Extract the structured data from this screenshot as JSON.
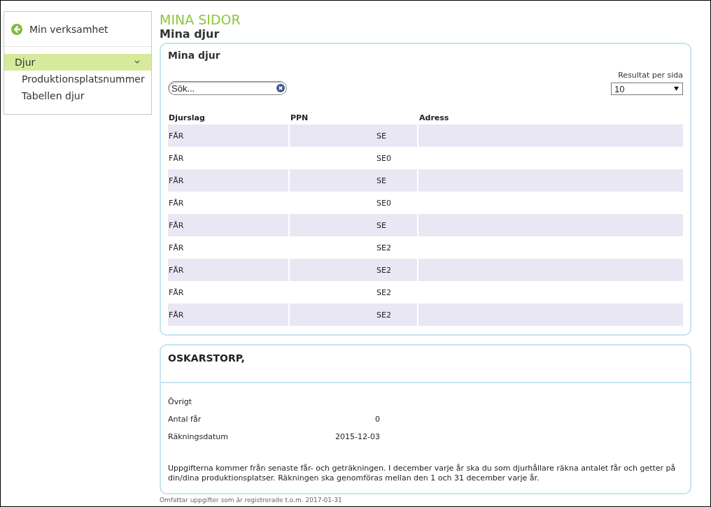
{
  "sidebar": {
    "back_link": "Min verksamhet",
    "items": [
      {
        "label": "Djur",
        "selected": true,
        "expanded": true,
        "children": [
          {
            "label": "Produktionsplatsnummer",
            "selected": false
          },
          {
            "label": "Tabellen djur",
            "selected": false
          }
        ]
      }
    ]
  },
  "header": {
    "section": "MINA SIDOR",
    "title": "Mina djur"
  },
  "animals_panel": {
    "title": "Mina djur",
    "search": {
      "placeholder": "Sök..."
    },
    "page_size": {
      "label": "Resultat per sida",
      "value": "10"
    },
    "table": {
      "columns": [
        "Djurslag",
        "PPN",
        "Adress"
      ],
      "rows": [
        {
          "cells": [
            "FÅR",
            "SE",
            ""
          ]
        },
        {
          "cells": [
            "FÅR",
            "SE0",
            ""
          ]
        },
        {
          "cells": [
            "FÅR",
            "SE",
            ""
          ]
        },
        {
          "cells": [
            "FÅR",
            "SE0",
            ""
          ]
        },
        {
          "cells": [
            "FÅR",
            "SE",
            ""
          ]
        },
        {
          "cells": [
            "FÅR",
            "SE2",
            ""
          ]
        },
        {
          "cells": [
            "FÅR",
            "SE2",
            ""
          ]
        },
        {
          "cells": [
            "FÅR",
            "SE2",
            ""
          ]
        },
        {
          "cells": [
            "FÅR",
            "SE2",
            ""
          ]
        }
      ]
    }
  },
  "farm_panel": {
    "title": "OSKARSTORP,",
    "fields": [
      {
        "label": "Övrigt"
      },
      {
        "label": "Antal får",
        "value": "0"
      },
      {
        "label": "Räkningsdatum",
        "value": "2015-12-03"
      }
    ],
    "note": "Uppgifterna kommer från senaste får- och geträkningen. I december varje år ska du som djurhållare räkna antalet får och getter på din/dina produktionsplatser. Räkningen ska genomföras mellan den 1 och 31 december varje år."
  },
  "footer_note": "Omfattar uppgifter som är registrerade t.o.m. 2017-01-31"
}
